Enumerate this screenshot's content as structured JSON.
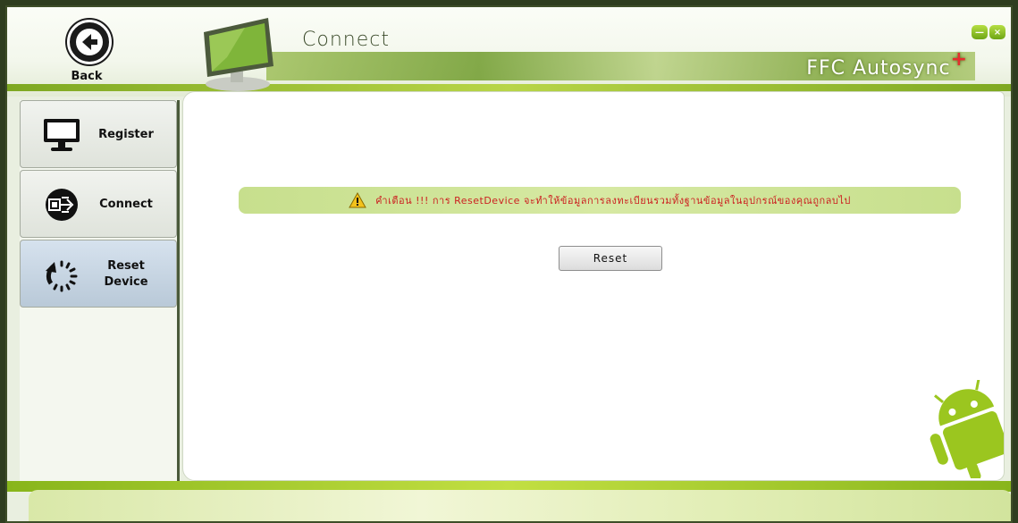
{
  "header": {
    "back_label": "Back",
    "page_title": "Connect",
    "brand": "FFC Autosync",
    "brand_mark": "+"
  },
  "window_controls": {
    "minimize": "—",
    "close": "×"
  },
  "sidebar": {
    "items": [
      {
        "label": "Register",
        "icon": "monitor-icon"
      },
      {
        "label": "Connect",
        "icon": "connect-plug-icon"
      },
      {
        "label": "Reset\nDevice",
        "icon": "reset-spinner-icon"
      }
    ]
  },
  "main": {
    "warning_text": "คำเตือน !!! การ ResetDevice จะทำให้ข้อมูลการลงทะเบียนรวมทั้งฐานข้อมูลในอุปกรณ์ของคุณถูกลบไป",
    "reset_button": "Reset"
  },
  "colors": {
    "accent_green": "#8ab81f",
    "warning_red": "#cc2121",
    "dark_frame": "#2f3d1f"
  }
}
